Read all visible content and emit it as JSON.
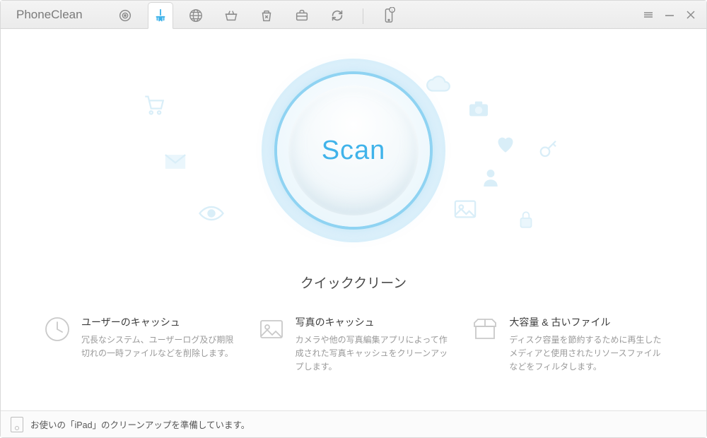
{
  "app": {
    "title": "PhoneClean"
  },
  "toolbar_icons": {
    "target": "target-icon",
    "clean": "clean-brush-icon",
    "globe": "globe-icon",
    "basket": "basket-icon",
    "recycle": "recycle-icon",
    "briefcase": "briefcase-icon",
    "refresh": "refresh-icon",
    "device": "device-icon"
  },
  "scan": {
    "button_label": "Scan",
    "section_title": "クイッククリーン"
  },
  "features": [
    {
      "title": "ユーザーのキャッシュ",
      "desc": "冗長なシステム、ユーザーログ及び期限切れの一時ファイルなどを削除します。"
    },
    {
      "title": "写真のキャッシュ",
      "desc": "カメラや他の写真編集アプリによって作成された写真キャッシュをクリーンアップします。"
    },
    {
      "title": "大容量 & 古いファイル",
      "desc": "ディスク容量を節約するために再生したメディアと使用されたリソースファイルなどをフィルタします。"
    }
  ],
  "status": {
    "text": "お使いの「iPad」のクリーンアップを準備しています。"
  },
  "colors": {
    "accent": "#40b3ea",
    "icon_muted": "#9a9a9a",
    "bg_icon": "#cfe8f3"
  }
}
